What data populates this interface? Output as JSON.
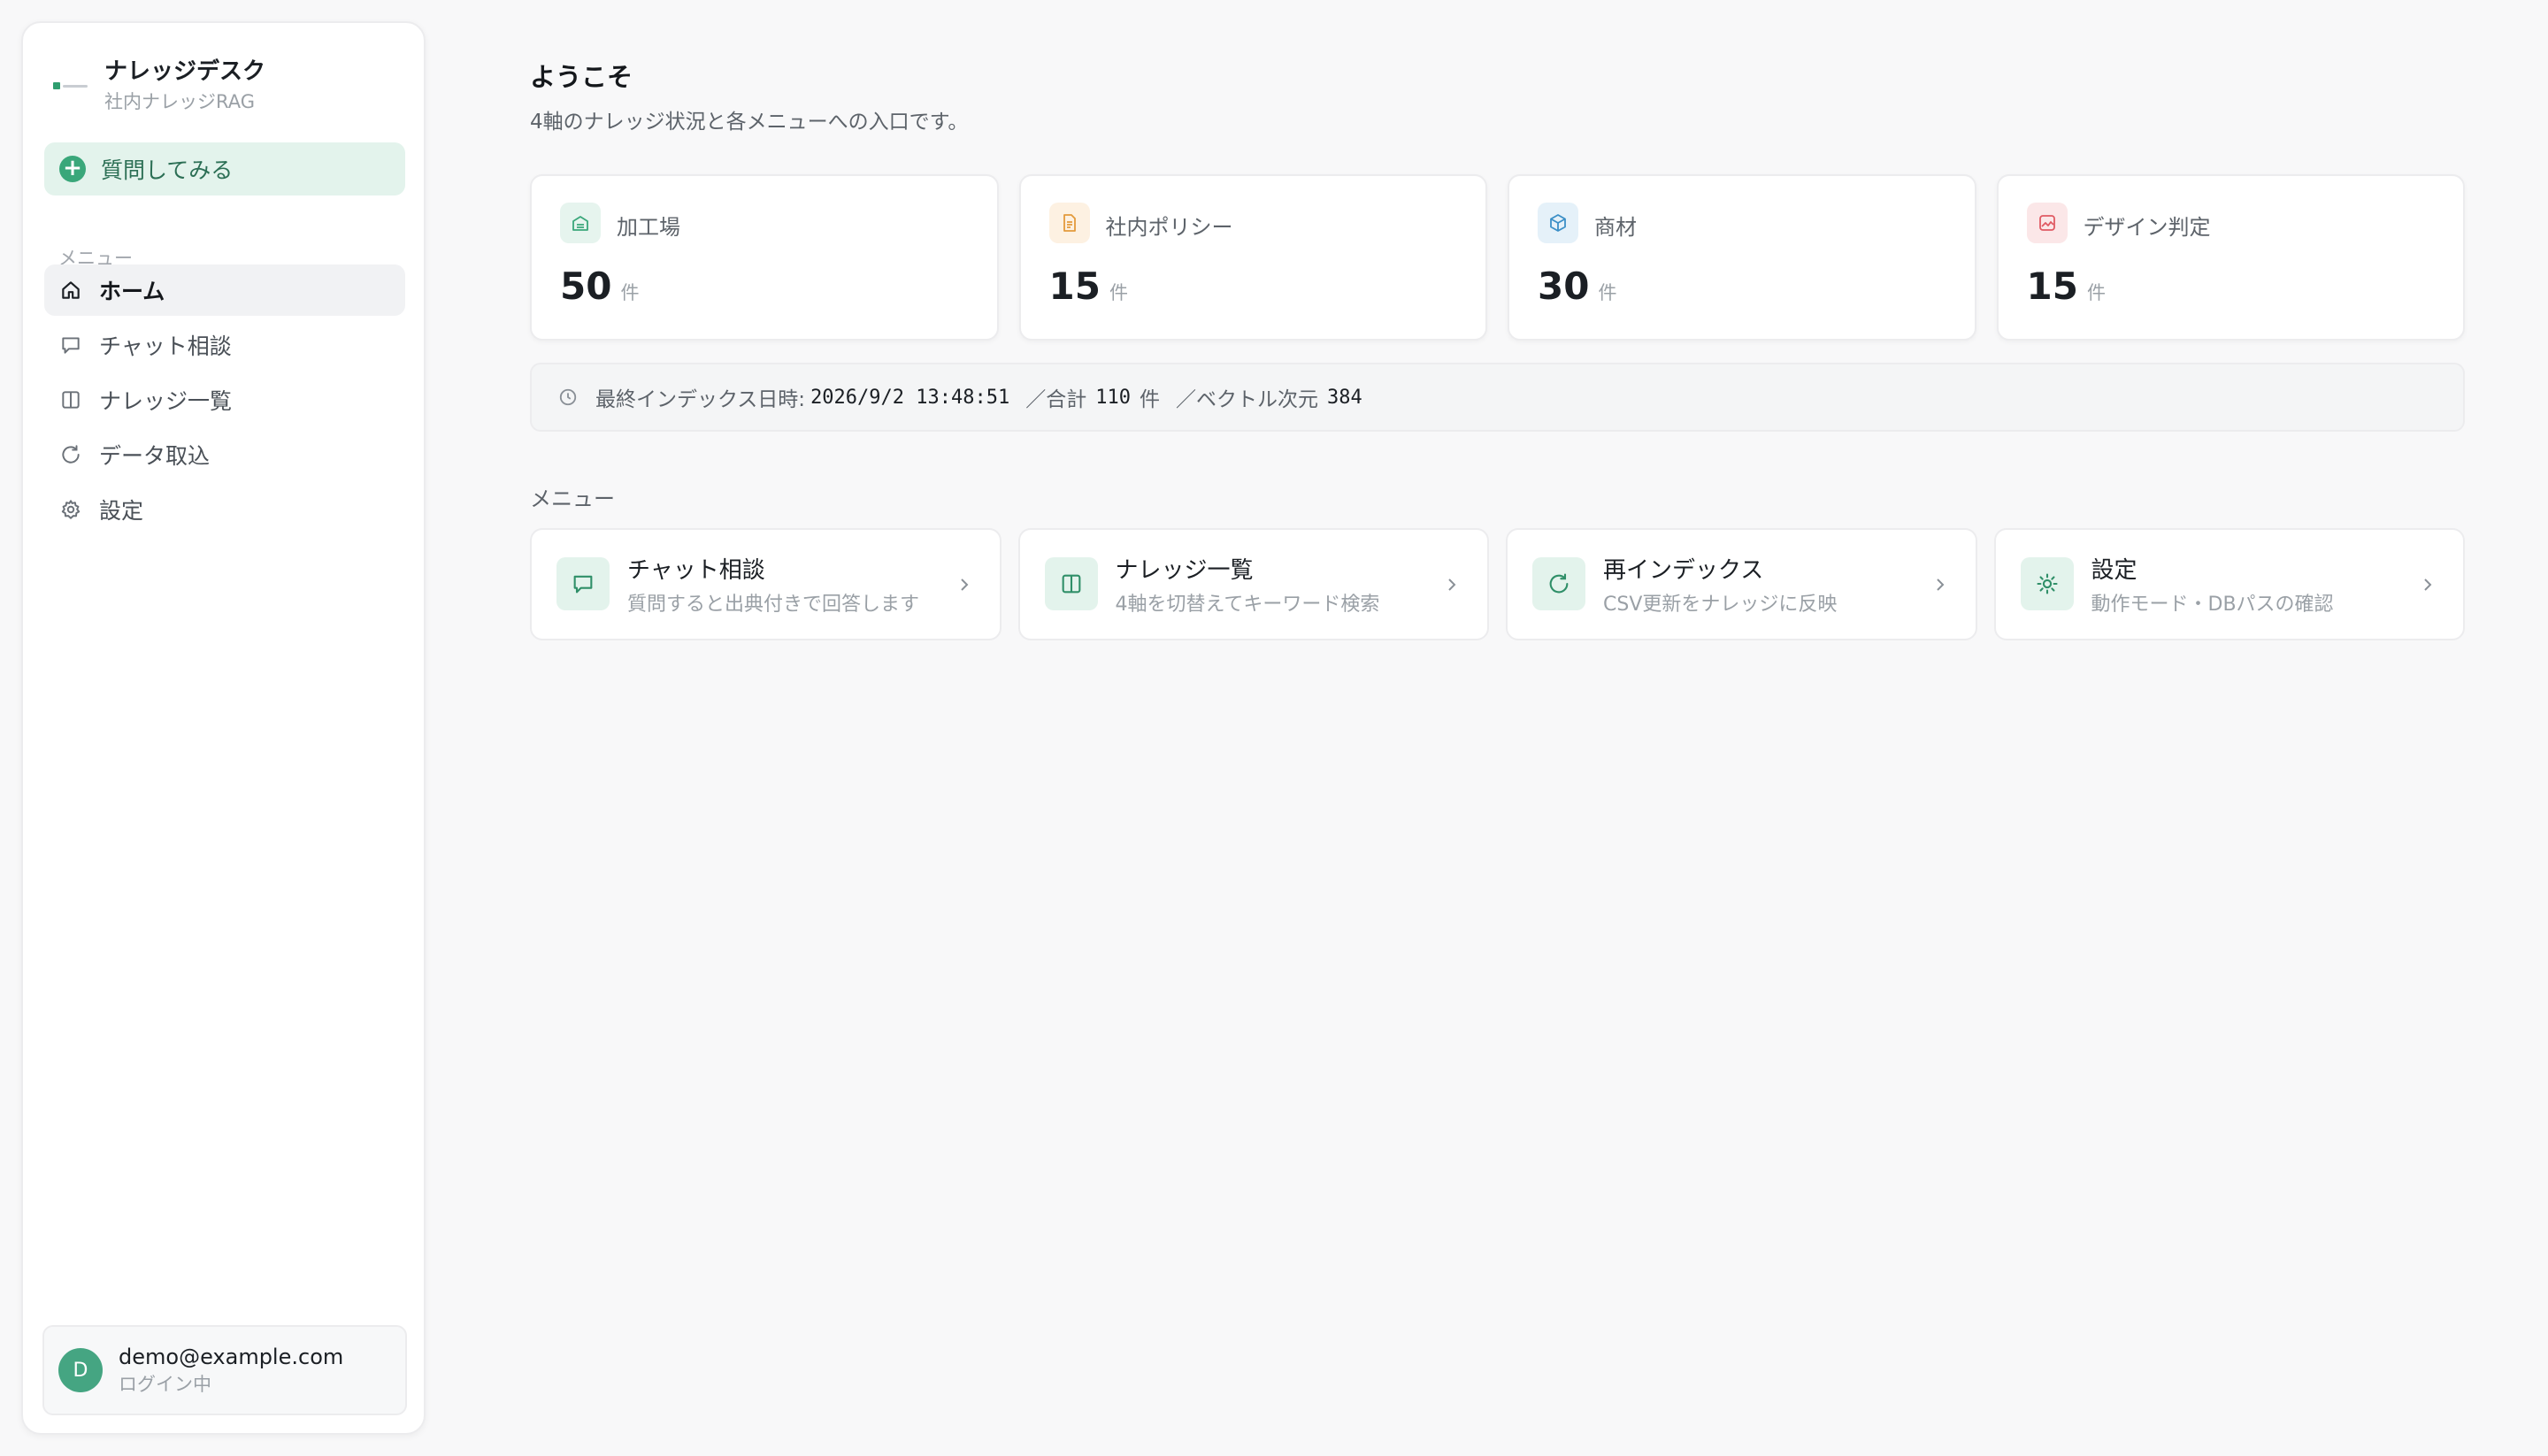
{
  "brand": {
    "title": "ナレッジデスク",
    "subtitle": "社内ナレッジRAG"
  },
  "ask_button": {
    "label": "質問してみる"
  },
  "sidebar": {
    "caption": "メニュー",
    "items": [
      {
        "label": "ホーム",
        "icon": "home-icon",
        "active": true
      },
      {
        "label": "チャット相談",
        "icon": "chat-icon",
        "active": false
      },
      {
        "label": "ナレッジ一覧",
        "icon": "book-icon",
        "active": false
      },
      {
        "label": "データ取込",
        "icon": "refresh-icon",
        "active": false
      },
      {
        "label": "設定",
        "icon": "gear-icon",
        "active": false
      }
    ]
  },
  "user": {
    "initial": "D",
    "email": "demo@example.com",
    "status": "ログイン中"
  },
  "header": {
    "title": "ようこそ",
    "subtitle": "4軸のナレッジ状況と各メニューへの入口です。"
  },
  "stats": [
    {
      "name": "加工場",
      "value": "50",
      "unit": "件",
      "icon": "factory-icon",
      "color": "#3aa77a",
      "bg": "#e6f4ee"
    },
    {
      "name": "社内ポリシー",
      "value": "15",
      "unit": "件",
      "icon": "document-icon",
      "color": "#e39a3b",
      "bg": "#fdf1e2"
    },
    {
      "name": "商材",
      "value": "30",
      "unit": "件",
      "icon": "box-icon",
      "color": "#3b8fc7",
      "bg": "#e5f1f9"
    },
    {
      "name": "デザイン判定",
      "value": "15",
      "unit": "件",
      "icon": "image-icon",
      "color": "#e05a63",
      "bg": "#fbe7e8"
    }
  ],
  "index": {
    "label": "最終インデックス日時:",
    "datetime": "2026/9/2 13:48:51",
    "total_label": "／合計",
    "total": "110",
    "total_unit": "件",
    "vector_label": "／ベクトル次元",
    "vector_dim": "384"
  },
  "menu": {
    "heading": "メニュー",
    "cards": [
      {
        "title": "チャット相談",
        "desc": "質問すると出典付きで回答します",
        "icon": "chat-icon"
      },
      {
        "title": "ナレッジ一覧",
        "desc": "4軸を切替えてキーワード検索",
        "icon": "book-icon"
      },
      {
        "title": "再インデックス",
        "desc": "CSV更新をナレッジに反映",
        "icon": "refresh-icon"
      },
      {
        "title": "設定",
        "desc": "動作モード・DBパスの確認",
        "icon": "gear-icon"
      }
    ]
  },
  "colors": {
    "accent": "#3aa77a",
    "accent_bg": "#e3f3ec",
    "background": "#f8f8f9"
  }
}
